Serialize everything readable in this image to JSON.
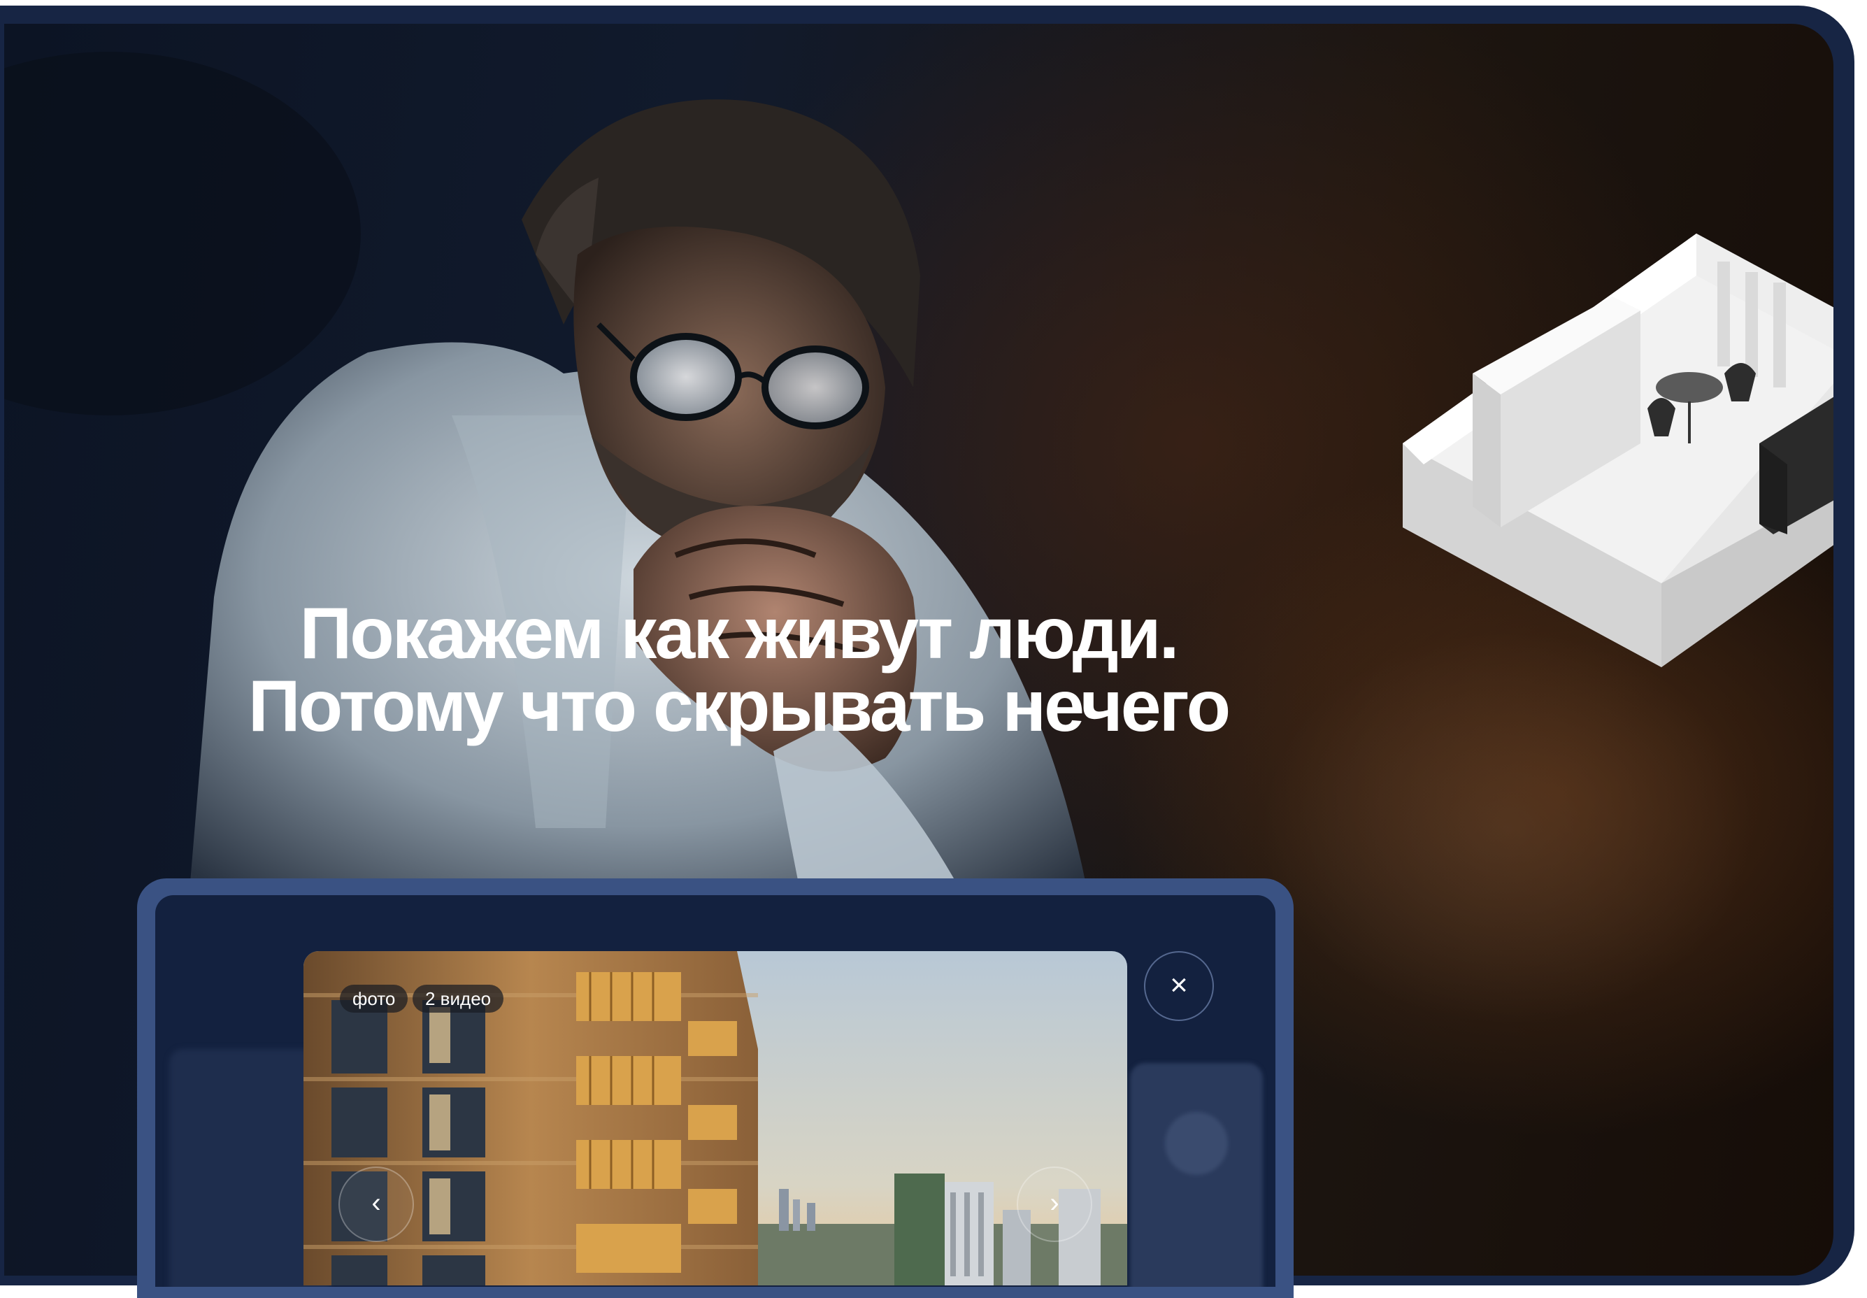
{
  "hero": {
    "headline_line1": "Покажем как живут люди.",
    "headline_line2": "Потому что скрывать нечего",
    "text_color": "#ffffff"
  },
  "gallery_modal": {
    "tabs": [
      {
        "label": "фото",
        "active": true
      },
      {
        "label": "2 видео",
        "active": false
      }
    ],
    "prev_icon": "‹",
    "next_icon": "›",
    "close_icon": "×",
    "frame_color": "#3a5283",
    "panel_color": "#13213f"
  },
  "icons": [
    "chevron-left-icon",
    "chevron-right-icon",
    "close-icon"
  ],
  "colors": {
    "accent": "#172544",
    "brick": "#b7864f",
    "sky": "#c9d3dc"
  }
}
